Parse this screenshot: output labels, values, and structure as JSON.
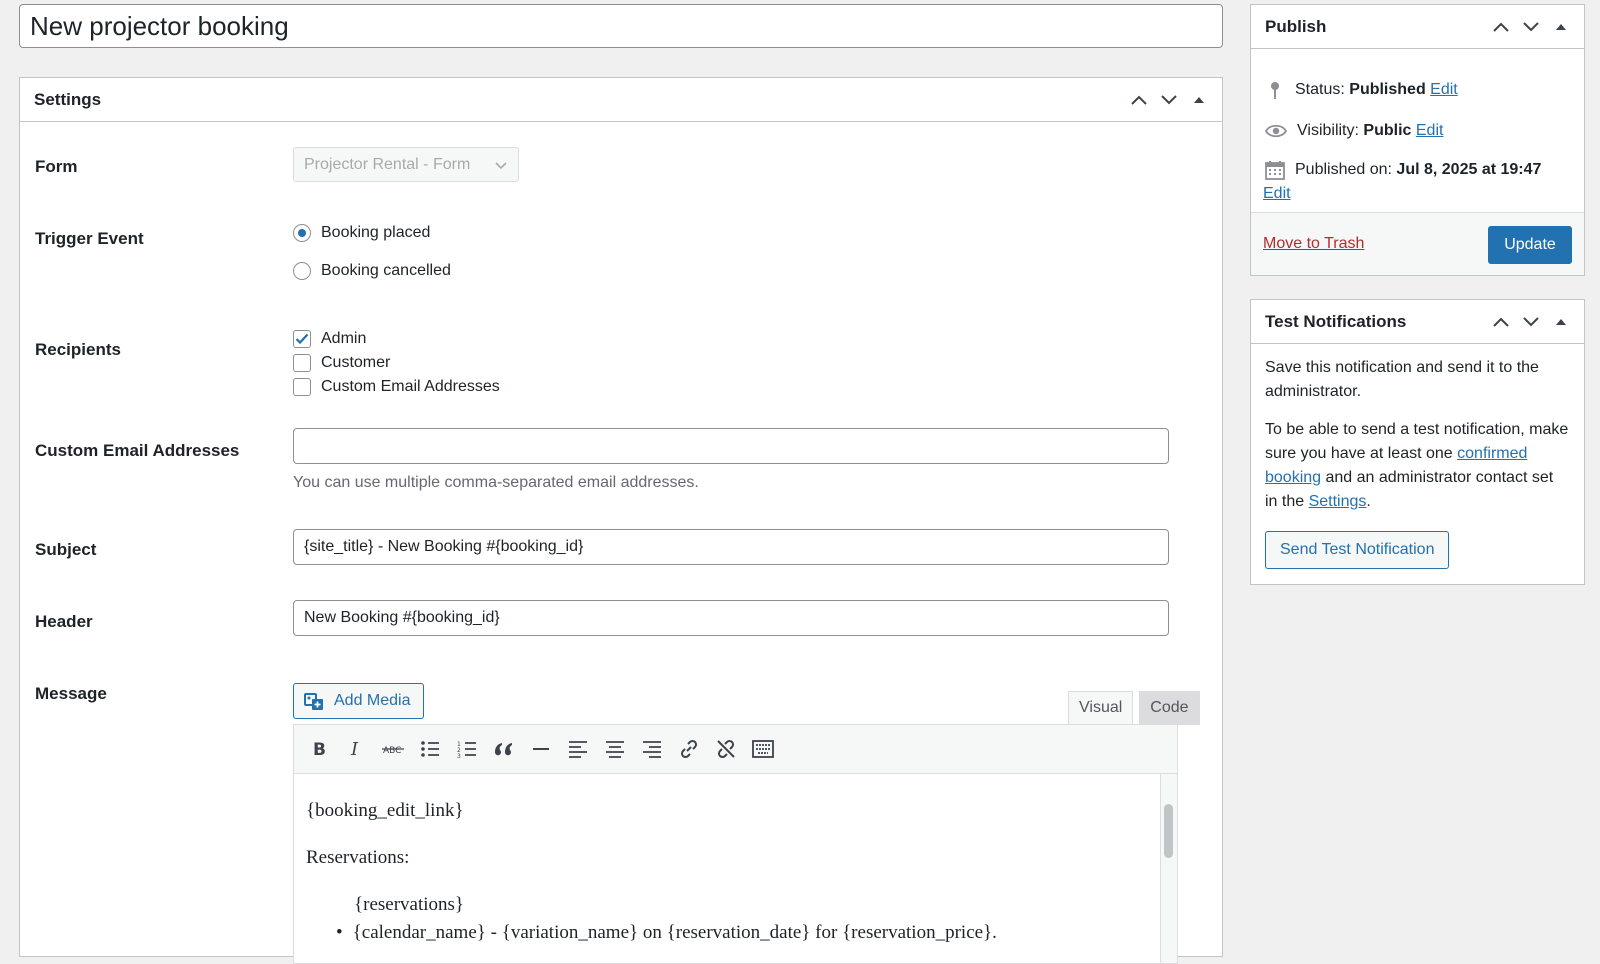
{
  "post_title": "New projector booking",
  "settings": {
    "title": "Settings",
    "form": {
      "label": "Form",
      "value": "Projector Rental - Form"
    },
    "trigger": {
      "label": "Trigger Event",
      "options": [
        "Booking placed",
        "Booking cancelled"
      ],
      "selected": "Booking placed"
    },
    "recipients": {
      "label": "Recipients",
      "options": [
        "Admin",
        "Customer",
        "Custom Email Addresses"
      ],
      "checked": [
        "Admin"
      ]
    },
    "custom_emails": {
      "label": "Custom Email Addresses",
      "value": "",
      "description": "You can use multiple comma-separated email addresses."
    },
    "subject": {
      "label": "Subject",
      "value": "{site_title} - New Booking #{booking_id}"
    },
    "header": {
      "label": "Header",
      "value": "New Booking #{booking_id}"
    },
    "message": {
      "label": "Message",
      "add_media": "Add Media",
      "tabs": [
        "Visual",
        "Code"
      ],
      "active_tab": "Visual",
      "toolbar_icons": [
        "bold-icon",
        "italic-icon",
        "strikethrough-icon",
        "bulleted-list-icon",
        "numbered-list-icon",
        "blockquote-icon",
        "horizontal-line-icon",
        "align-left-icon",
        "align-center-icon",
        "align-right-icon",
        "insert-link-icon",
        "remove-link-icon",
        "toolbar-toggle-icon"
      ],
      "content": {
        "line1": "{booking_edit_link}",
        "line2": "Reservations:",
        "line3": "{reservations}",
        "bullet1": "{calendar_name} - {variation_name} on {reservation_date} for {reservation_price}."
      }
    }
  },
  "publish": {
    "title": "Publish",
    "status_label": "Status:",
    "status_value": "Published",
    "visibility_label": "Visibility:",
    "visibility_value": "Public",
    "published_label": "Published on:",
    "published_value": "Jul 8, 2025 at 19:47",
    "edit": "Edit",
    "trash": "Move to Trash",
    "update": "Update"
  },
  "test": {
    "title": "Test Notifications",
    "p1": "Save this notification and send it to the administrator.",
    "p2_a": "To be able to send a test notification, make sure you have at least one",
    "p2_link": "confirmed booking",
    "p2_b": "and an administrator contact set in the",
    "p2_link2": "Settings",
    "p2_c": ".",
    "button": "Send Test Notification"
  },
  "colors": {
    "accent": "#2271b1",
    "danger": "#b32d2e",
    "border": "#c3c4c7",
    "background": "#f0f0f1"
  }
}
